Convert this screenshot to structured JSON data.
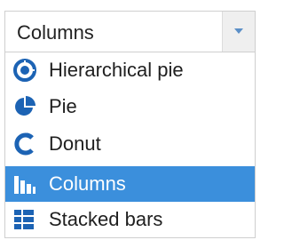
{
  "select": {
    "value": "Columns"
  },
  "options": [
    {
      "label": "Hierarchical pie",
      "icon": "hierarchical-pie-icon"
    },
    {
      "label": "Pie",
      "icon": "pie-icon"
    },
    {
      "label": "Donut",
      "icon": "donut-icon"
    },
    {
      "label": "Columns",
      "icon": "columns-icon",
      "selected": true
    },
    {
      "label": "Stacked bars",
      "icon": "stacked-bars-icon"
    }
  ],
  "colors": {
    "icon": "#1c63b4",
    "selected_background": "#3b8fdc",
    "selected_text": "#ffffff",
    "arrow": "#5b8fc7"
  }
}
